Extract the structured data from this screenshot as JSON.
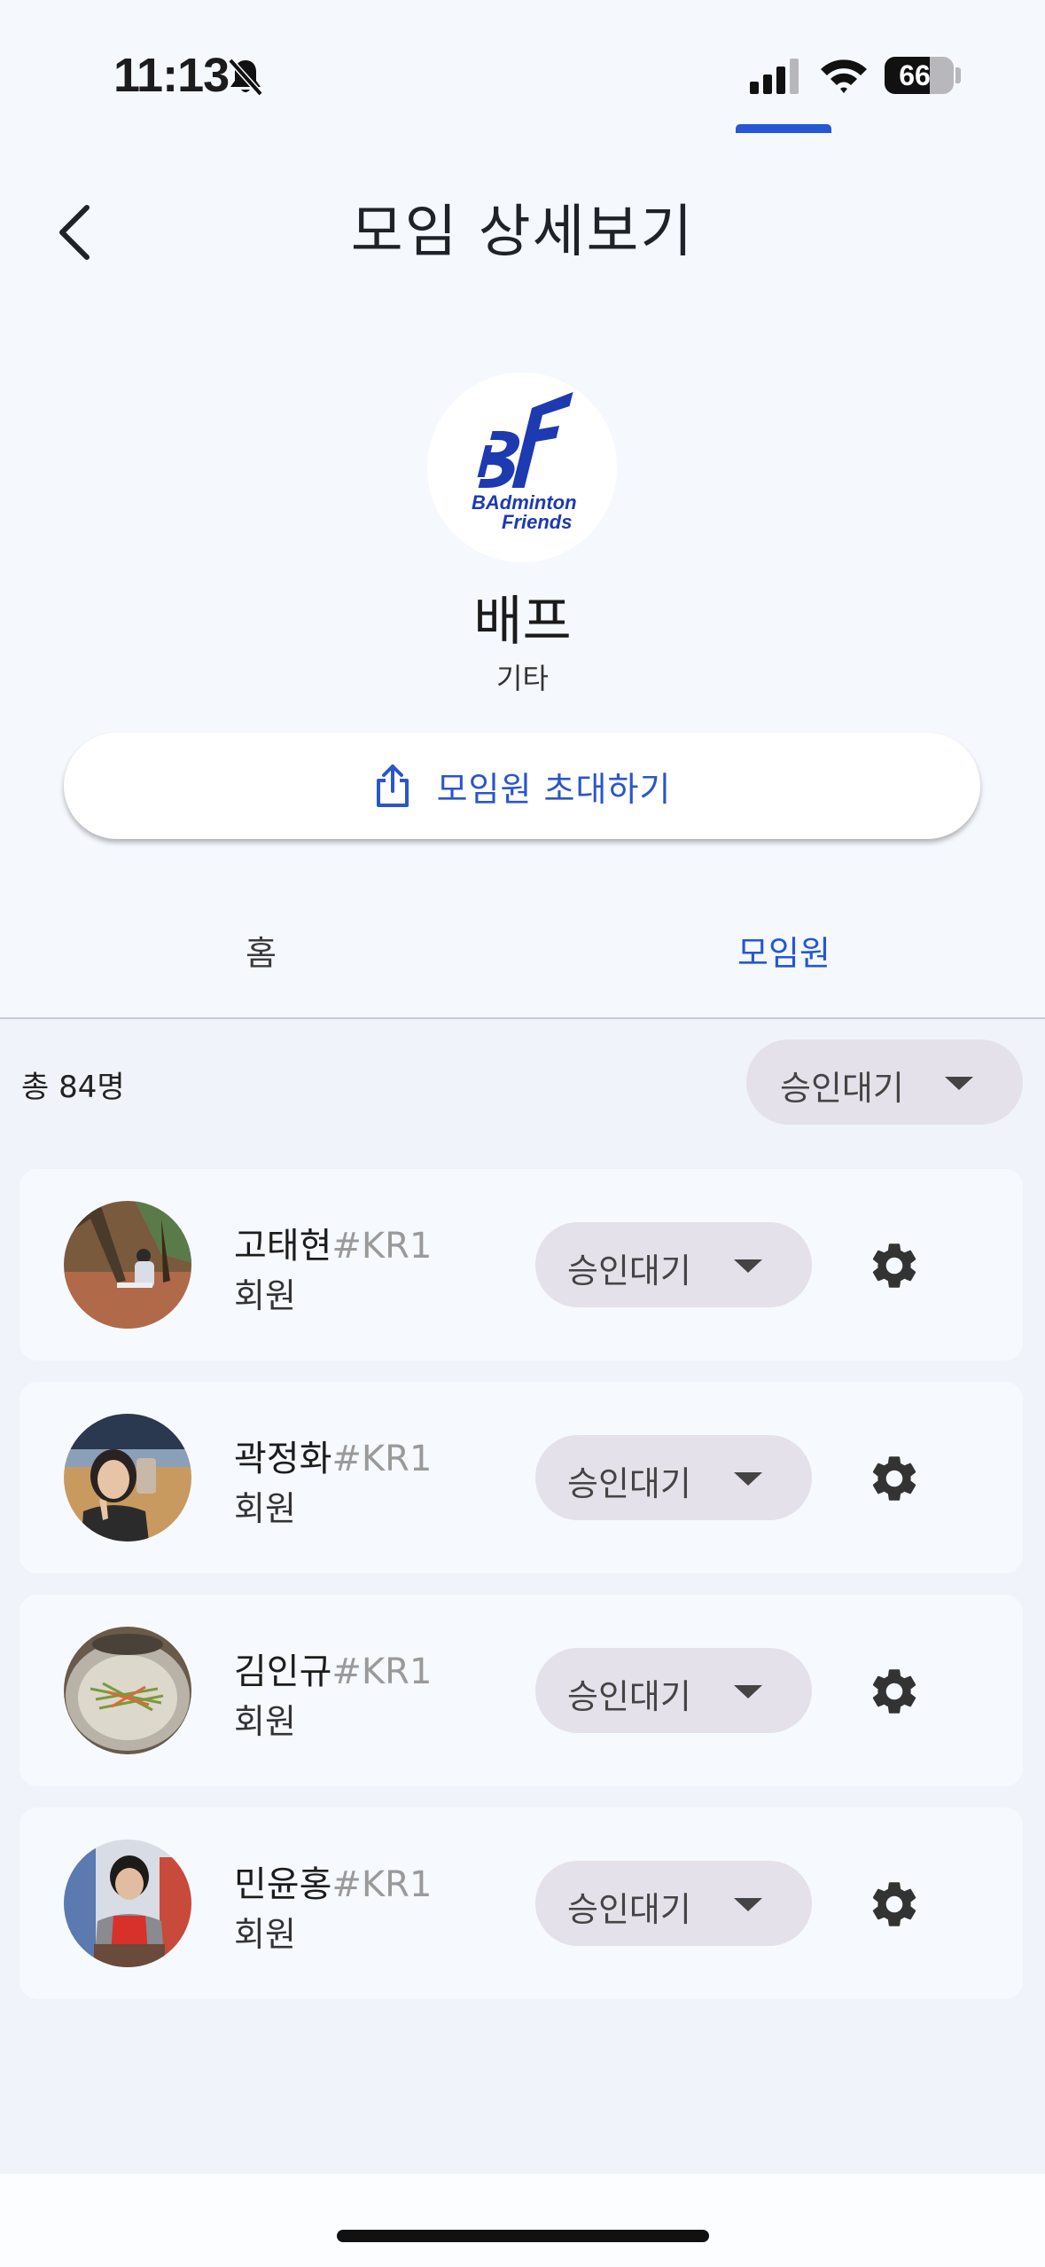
{
  "status_bar": {
    "time": "11:13",
    "battery": "66",
    "battery_level": 0.66
  },
  "header": {
    "title": "모임 상세보기",
    "back_icon": "chevron-left-icon"
  },
  "group": {
    "logo_text_top": "BF",
    "logo_line1": "BAdminton",
    "logo_line2": "Friends",
    "name": "배프",
    "category": "기타",
    "invite_label": "모임원 초대하기",
    "accent_color": "#2456d6"
  },
  "tabs": [
    {
      "label": "홈",
      "selected": false
    },
    {
      "label": "모임원",
      "selected": true
    }
  ],
  "members_section": {
    "total": "총 84명",
    "filter_value": "승인대기"
  },
  "members": [
    {
      "name": "고태현",
      "tag": "#KR1",
      "role": "회원",
      "status": "승인대기"
    },
    {
      "name": "곽정화",
      "tag": "#KR1",
      "role": "회원",
      "status": "승인대기"
    },
    {
      "name": "김인규",
      "tag": "#KR1",
      "role": "회원",
      "status": "승인대기"
    },
    {
      "name": "민윤홍",
      "tag": "#KR1",
      "role": "회원",
      "status": "승인대기"
    }
  ]
}
